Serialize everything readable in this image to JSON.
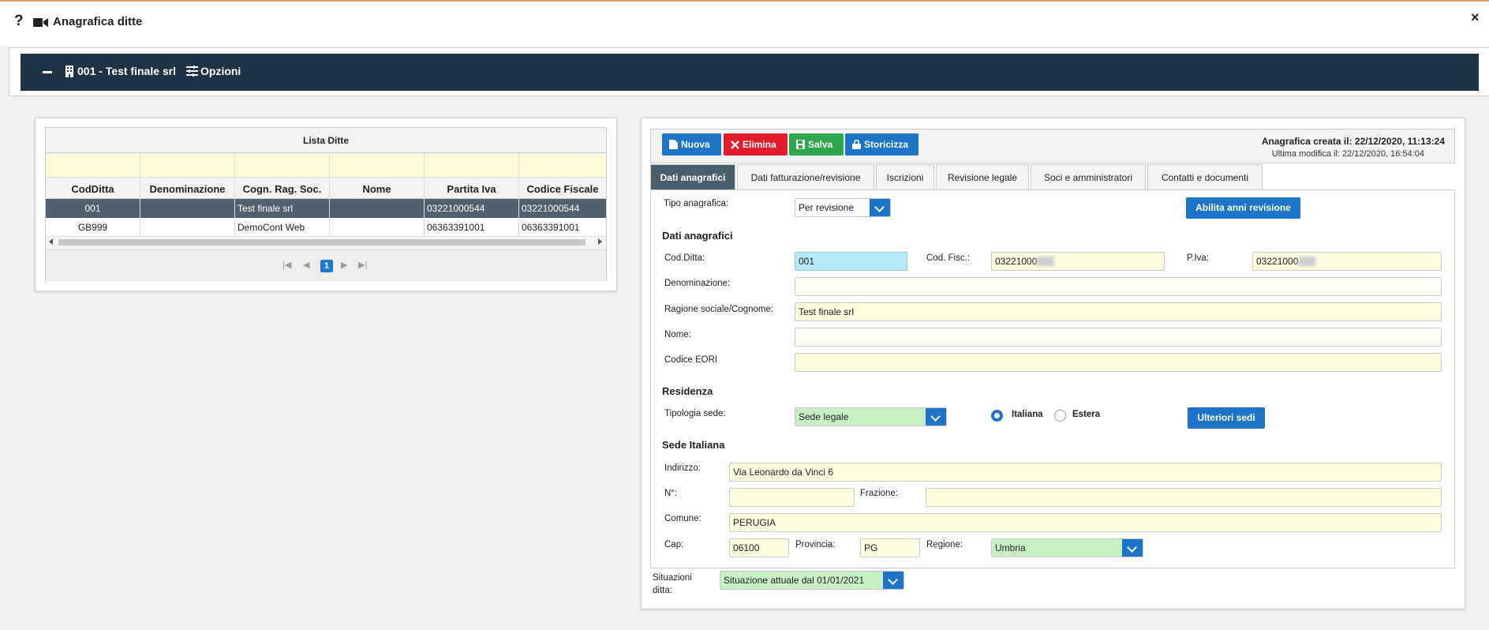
{
  "window": {
    "help": "?",
    "title": "Anagrafica ditte",
    "close": "×"
  },
  "navbar": {
    "ditta": "001 - Test finale srl",
    "options": "Opzioni"
  },
  "list": {
    "title": "Lista Ditte",
    "columns": [
      "CodDitta",
      "Denominazione",
      "Cogn. Rag. Soc.",
      "Nome",
      "Partita Iva",
      "Codice Fiscale"
    ],
    "rows": [
      [
        "001",
        "",
        "Test finale srl",
        "",
        "03221000544",
        "03221000544"
      ],
      [
        "GB999",
        "",
        "DemoCont Web",
        "",
        "06363391001",
        "06363391001"
      ]
    ],
    "pager": {
      "current": "1"
    }
  },
  "toolbar": {
    "new": "Nuova",
    "delete": "Elimina",
    "save": "Salva",
    "history": "Storicizza",
    "created": "Anagrafica creata il: 22/12/2020, 11:13:24",
    "modified": "Ultima modifica il: 22/12/2020, 16:54:04",
    "colors": {
      "new": "#1d74c8",
      "delete": "#e21c2a",
      "save": "#2ea84a",
      "history": "#1d74c8"
    }
  },
  "tabs": [
    "Dati anagrafici",
    "Dati fatturazione/revisione",
    "Iscrizioni",
    "Revisione legale",
    "Soci e amministratori",
    "Contatti e documenti"
  ],
  "form": {
    "tipo_label": "Tipo anagrafica:",
    "tipo_value": "Per revisione",
    "abilita_button": "Abilita anni revisione",
    "sect_dati": "Dati anagrafici",
    "codditta_label": "Cod.Ditta:",
    "codditta_value": "001",
    "codfisc_label": "Cod. Fisc.:",
    "codfisc_value": "03221000",
    "piva_label": "P.Iva:",
    "piva_value": "03221000",
    "denominazione_label": "Denominazione:",
    "denominazione_value": "",
    "ragione_label": "Ragione sociale/Cognome:",
    "ragione_value": "Test finale srl",
    "nome_label": "Nome:",
    "nome_value": "",
    "eori_label": "Codice EORI",
    "eori_value": "",
    "sect_residenza": "Residenza",
    "tipologia_label": "Tipologia sede:",
    "tipologia_value": "Sede legale",
    "radio_italiana": "Italiana",
    "radio_estera": "Estera",
    "ulteriori_button": "Ulteriori sedi",
    "sect_sede": "Sede Italiana",
    "indirizzo_label": "Indirizzo:",
    "indirizzo_value": "Via Leonardo da Vinci 6",
    "numero_label": "N°:",
    "numero_value": "",
    "frazione_label": "Frazione:",
    "frazione_value": "",
    "comune_label": "Comune:",
    "comune_value": "PERUGIA",
    "cap_label": "Cap:",
    "cap_value": "06100",
    "provincia_label": "Provincia:",
    "provincia_value": "PG",
    "regione_label": "Regione:",
    "regione_value": "Umbria"
  },
  "situazioni": {
    "label": "Situazioni ditta:",
    "value": "Situazione attuale dal 01/01/2021"
  }
}
